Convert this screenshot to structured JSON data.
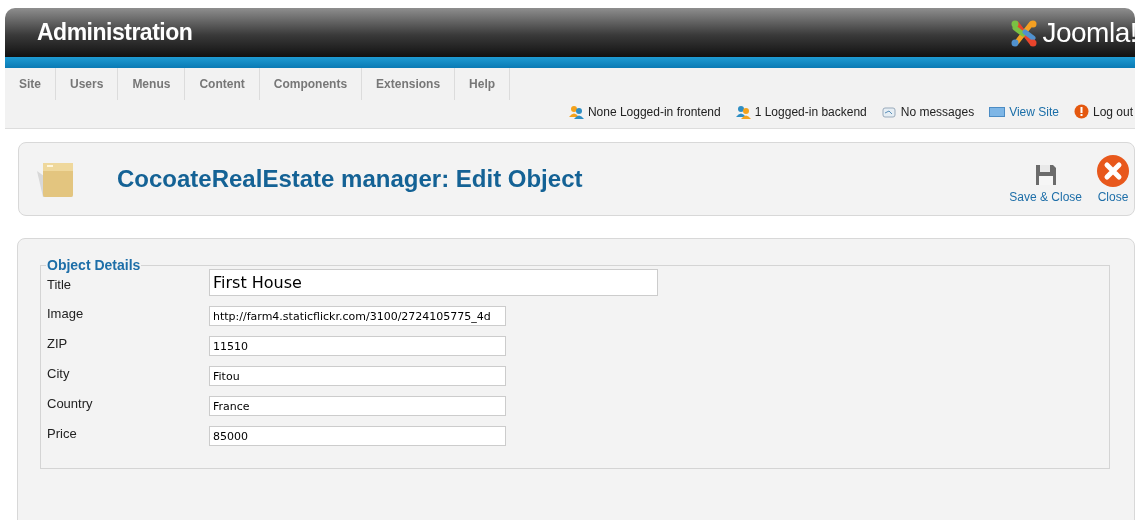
{
  "header": {
    "title": "Administration",
    "logo_text": "Joomla!"
  },
  "menu": [
    "Site",
    "Users",
    "Menus",
    "Content",
    "Components",
    "Extensions",
    "Help"
  ],
  "status": [
    {
      "kind": "frontend-users",
      "label": "None Logged-in frontend"
    },
    {
      "kind": "backend-users",
      "label": "1 Logged-in backend"
    },
    {
      "kind": "messages",
      "label": "No messages"
    },
    {
      "kind": "view-site",
      "label": "View Site"
    },
    {
      "kind": "logout",
      "label": "Log out"
    }
  ],
  "toolbar": {
    "title": "CocoateRealEstate manager: Edit Object",
    "buttons": [
      {
        "kind": "save",
        "label": "Save & Close"
      },
      {
        "kind": "close",
        "label": "Close"
      }
    ]
  },
  "form": {
    "legend": "Object Details",
    "fields": [
      {
        "kind": "large",
        "label": "Title",
        "value": "First House"
      },
      {
        "kind": "small",
        "label": "Image",
        "value": "http://farm4.staticflickr.com/3100/2724105775_4d"
      },
      {
        "kind": "small",
        "label": "ZIP",
        "value": "11510"
      },
      {
        "kind": "small",
        "label": "City",
        "value": "Fitou"
      },
      {
        "kind": "small",
        "label": "Country",
        "value": "France"
      },
      {
        "kind": "small",
        "label": "Price",
        "value": "85000"
      }
    ]
  }
}
